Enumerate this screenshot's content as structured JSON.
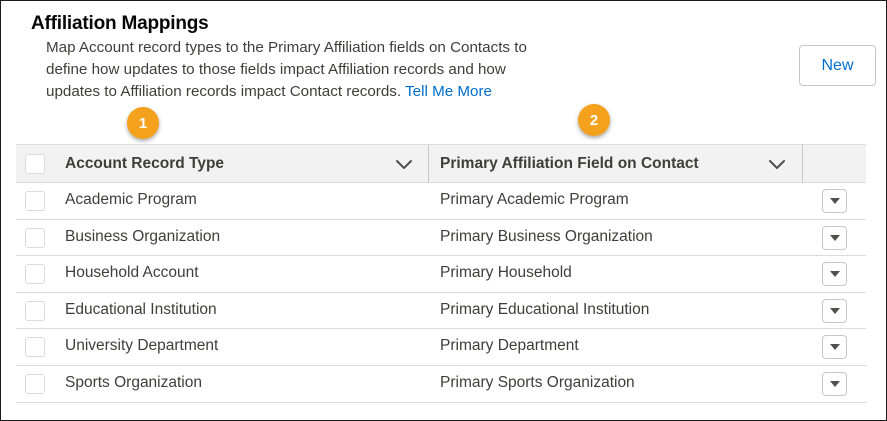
{
  "header": {
    "title": "Affiliation Mappings",
    "description_line1": "Map Account record types to the Primary Affiliation fields on Contacts to",
    "description_line2": "define how updates to those fields impact Affiliation records and how",
    "description_line3": "updates to Affiliation records impact Contact records.",
    "help_link": "Tell Me More",
    "new_button": "New"
  },
  "callouts": [
    "1",
    "2"
  ],
  "table": {
    "columns": [
      "Account Record Type",
      "Primary Affiliation Field on Contact"
    ],
    "rows": [
      [
        "Academic Program",
        "Primary Academic Program"
      ],
      [
        "Business Organization",
        "Primary Business Organization"
      ],
      [
        "Household Account",
        "Primary Household"
      ],
      [
        "Educational Institution",
        "Primary Educational Institution"
      ],
      [
        "University Department",
        "Primary Department"
      ],
      [
        "Sports Organization",
        "Primary Sports Organization"
      ]
    ]
  },
  "icons": {
    "column_sort": "chevron-down-icon",
    "row_action": "caret-down-icon"
  }
}
